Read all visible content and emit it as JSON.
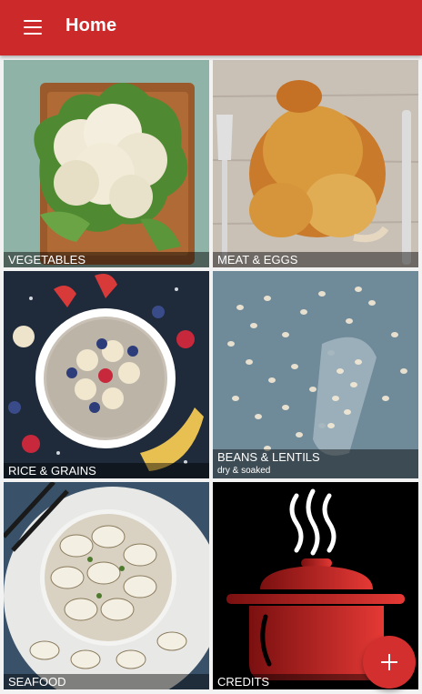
{
  "app": {
    "title": "Home",
    "accent": "#cc2a2a",
    "fab_color": "#d32f2f"
  },
  "toolbar": {
    "menu_icon": "hamburger-menu-icon"
  },
  "categories": [
    {
      "name": "VEGETABLES",
      "subtitle": ""
    },
    {
      "name": "MEAT & EGGS",
      "subtitle": ""
    },
    {
      "name": "RICE & GRAINS",
      "subtitle": ""
    },
    {
      "name": "BEANS & LENTILS",
      "subtitle": "dry & soaked"
    },
    {
      "name": "SEAFOOD",
      "subtitle": ""
    },
    {
      "name": "CREDITS",
      "subtitle": ""
    }
  ],
  "fab": {
    "icon": "plus-icon"
  }
}
